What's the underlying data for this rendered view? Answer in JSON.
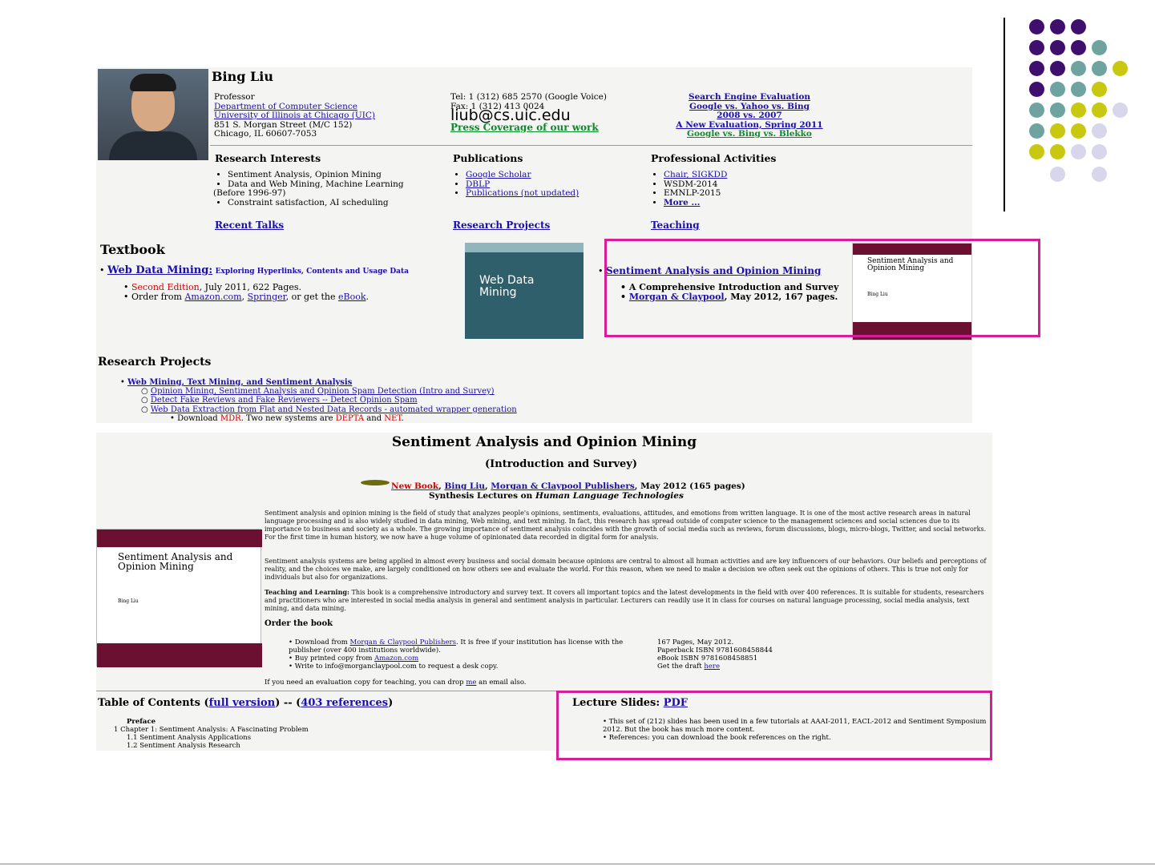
{
  "profile": {
    "name": "Bing Liu",
    "title": "Professor",
    "dept": "Department of Computer Science",
    "univ": "University of Illinois at Chicago (UIC)",
    "address": "851 S. Morgan Street (M/C 152)",
    "city": "Chicago, IL 60607-7053",
    "tel": "Tel: 1 (312) 685 2570 (Google Voice)",
    "fax": "Fax: 1 (312) 413 0024",
    "email": "liub@cs.uic.edu",
    "press": "Press Coverage of our work",
    "eval": [
      "Search Engine Evaluation",
      "Google vs. Yahoo vs. Bing",
      "2008 vs. 2007",
      "A New Evaluation, Spring 2011",
      "Google vs. Bing vs. Blekko"
    ]
  },
  "sections": {
    "research_title": "Research Interests",
    "research_items": [
      "Sentiment Analysis, Opinion Mining",
      "Data and Web Mining, Machine Learning",
      "(Before 1996-97)",
      "Constraint satisfaction, AI scheduling"
    ],
    "pub_title": "Publications",
    "pub_items": [
      "Google Scholar",
      "DBLP",
      "Publications (not updated)"
    ],
    "prof_title": "Professional Activities",
    "prof_items": [
      "Chair, SIGKDD",
      "WSDM-2014",
      "EMNLP-2015",
      "More ..."
    ],
    "links": [
      "Recent Talks",
      "Research Projects",
      "Teaching"
    ]
  },
  "textbook": {
    "heading": "Textbook",
    "book_link": "Web Data Mining:",
    "book_sub": "Exploring Hyperlinks, Contents and Usage Data",
    "edition": "Second Edition",
    "edition_rest": ", July 2011, 622 Pages.",
    "order_pre": "Order from",
    "amazon": "Amazon.com",
    "springer": "Springer",
    "order_mid": ", or get the",
    "ebook": "eBook",
    "cover_title": "Web Data Mining",
    "sa_link": "Sentiment Analysis and Opinion Mining",
    "sa_item1": "A Comprehensive Introduction and Survey",
    "sa_link2": "Morgan & Claypool",
    "sa_item2_rest": ", May 2012, 167 pages.",
    "sa_cover_title": "Sentiment Analysis and Opinion Mining",
    "sa_cover_author": "Bing Liu"
  },
  "projects": {
    "heading": "Research Projects",
    "item1": "Web Mining, Text Mining, and Sentiment Analysis",
    "sub1": "Opinion Mining, Sentiment Analysis and Opinion Spam Detection (Intro and Survey)",
    "sub2": "Detect Fake Reviews and Fake Reviewers -- Detect Opinion Spam",
    "sub3": "Web Data Extraction from Flat and Nested Data Records - automated wrapper generation",
    "sub4_pre": "Download",
    "sub4_mdr": "MDR",
    "sub4_mid": ". Two new systems are",
    "sub4_depta": "DEPTA",
    "sub4_and": "and",
    "sub4_net": "NET"
  },
  "bookpage": {
    "title": "Sentiment Analysis and Opinion Mining",
    "subtitle": "(Introduction and Survey)",
    "newbook": "New Book",
    "author": "Bing Liu",
    "publisher": "Morgan & Claypool Publishers",
    "date": ", May 2012 (165 pages)",
    "series_pre": "Synthesis Lectures on",
    "series": "Human Language Technologies",
    "para1": "Sentiment analysis and opinion mining is the field of study that analyzes people's opinions, sentiments, evaluations, attitudes, and emotions from written language. It is one of the most active research areas in natural language processing and is also widely studied in data mining, Web mining, and text mining. In fact, this research has spread outside of computer science to the management sciences and social sciences due to its importance to business and society as a whole. The growing importance of sentiment analysis coincides with the growth of social media such as reviews, forum discussions, blogs, micro-blogs, Twitter, and social networks. For the first time in human history, we now have a huge volume of opinionated data recorded in digital form for analysis.",
    "para2": "Sentiment analysis systems are being applied in almost every business and social domain because opinions are central to almost all human activities and are key influencers of our behaviors. Our beliefs and perceptions of reality, and the choices we make, are largely conditioned on how others see and evaluate the world. For this reason, when we need to make a decision we often seek out the opinions of others. This is true not only for individuals but also for organizations.",
    "para3_bold": "Teaching and Learning:",
    "para3": " This book is a comprehensive introductory and survey text. It covers all important topics and the latest developments in the field with over 400 references. It is suitable for students, researchers and practitioners who are interested in social media analysis in general and sentiment analysis in particular. Lecturers can readily use it in class for courses on natural language processing, social media analysis, text mining, and data mining.",
    "order_title": "Order the book",
    "order1_pre": "Download from",
    "order1_link": "Morgan & Claypool Publishers",
    "order1_rest": ". It is free if your institution has license with the publisher (over 400 institutions worldwide).",
    "order2_pre": "Buy printed copy from",
    "order2_link": "Amazon.com",
    "order3": "Write to info@morganclaypool.com to request a desk copy.",
    "spec1": "167 Pages, May 2012.",
    "spec2": "Paperback ISBN 9781608458844",
    "spec3": "eBook ISBN 9781608458851",
    "spec4_pre": "Get the draft",
    "spec4_link": "here",
    "eval_note_pre": "If you need an evaluation copy for teaching, you can drop",
    "eval_note_link": "me",
    "eval_note_post": "an email also.",
    "toc_pre": "Table of Contents (",
    "toc_link": "full version",
    "toc_mid": ") -- (",
    "toc_refs": "403 references",
    "toc_post": ")",
    "toc_items": [
      "Preface",
      "1   Chapter 1: Sentiment Analysis: A Fascinating Problem",
      "1.1 Sentiment Analysis Applications",
      "1.2 Sentiment Analysis Research"
    ],
    "slides_pre": "Lecture Slides:",
    "slides_link": "PDF",
    "slides_item1": "This set of (212) slides has been used in a few tutorials at AAAI-2011, EACL-2012 and Sentiment Symposium 2012. But the book has much more content.",
    "slides_item2": "References: you can download the book references on the right.",
    "cover_title": "Sentiment Analysis and Opinion Mining",
    "cover_author": "Bing Liu"
  },
  "colors": {
    "purple": "#3f0f6e",
    "teal": "#6fa3a0",
    "lime": "#c8c811",
    "lavender": "#d8d6ea",
    "highlight": "#d61d9a"
  }
}
